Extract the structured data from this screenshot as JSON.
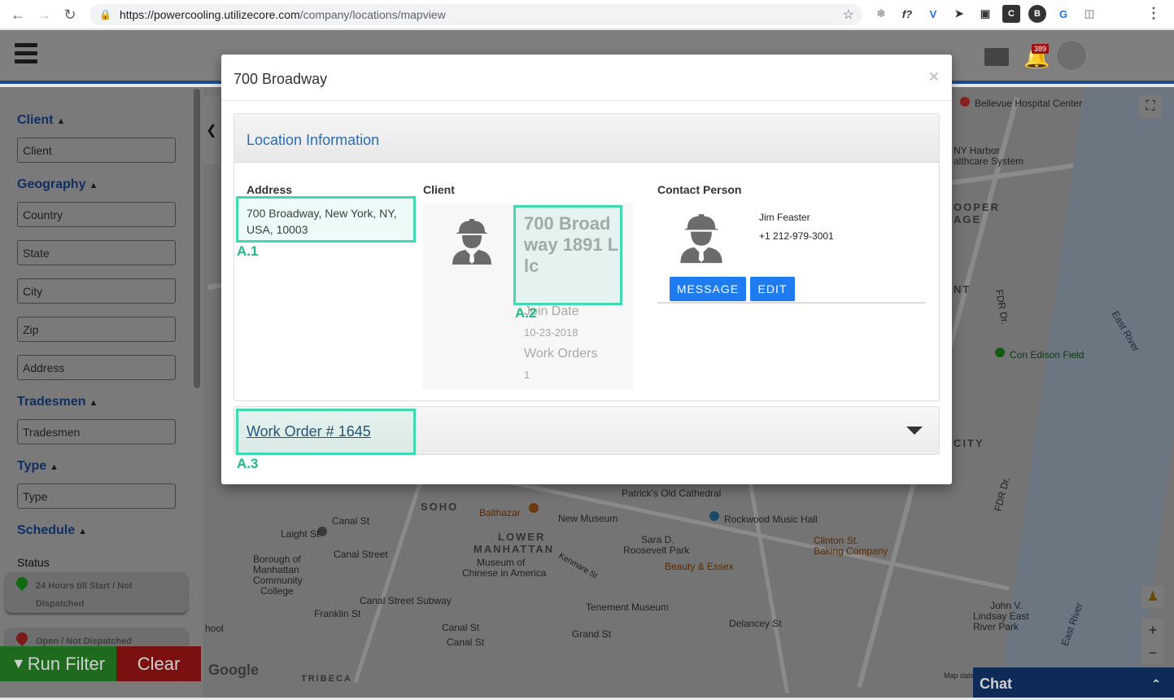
{
  "browser": {
    "url_host": "https://powercooling.utilizecore.com",
    "url_path": "/company/locations/mapview"
  },
  "header": {
    "notification_count": "389"
  },
  "sidebar": {
    "sections": {
      "client": "Client",
      "geography": "Geography",
      "tradesmen": "Tradesmen",
      "type": "Type",
      "schedule": "Schedule"
    },
    "placeholders": {
      "client": "Client",
      "country": "Country",
      "state": "State",
      "city": "City",
      "zip": "Zip",
      "address": "Address",
      "tradesmen": "Tradesmen",
      "type": "Type"
    },
    "status_label": "Status",
    "status_cards": [
      {
        "label": "24 Hours till Start / Not Dispatched",
        "color": "#0f6a0f"
      },
      {
        "label": "Open / Not Dispatched",
        "color": "#7a1a1a"
      }
    ],
    "run_filter_label": "Run Filter",
    "clear_label": "Clear"
  },
  "map": {
    "labels": {
      "bellevue": "Bellevue Hospital Center",
      "ny_harbor": "NY Harbor",
      "healthcare": "althcare System",
      "cooper": "OOPER",
      "age": "AGE",
      "nt": "NT",
      "fdr1": "FDR Dr.",
      "east_river1": "East River",
      "con_edison": "Con Edison Field",
      "city": "CITY",
      "fdr2": "FDR Dr.",
      "soho": "SOHO",
      "balthazar": "Balthazar",
      "new_museum": "New Museum",
      "rockwood": "Rockwood Music Hall",
      "lower": "LOWER",
      "manhattan": "MANHATTAN",
      "museum_chinese_1": "Museum of",
      "museum_chinese_2": "Chinese in America",
      "sara_d": "Sara D.",
      "roosevelt": "Roosevelt Park",
      "clinton_st": "Clinton St.",
      "baking": "Baking Company",
      "beauty": "Beauty & Essex",
      "canal_st_1": "Canal St",
      "canal_street": "Canal Street",
      "canal_street_subway": "Canal Street Subway",
      "canal_st_2": "Canal St",
      "canal_st_3": "Canal St",
      "franklin": "Franklin St",
      "grand_st": "Grand St",
      "tenement": "Tenement Museum",
      "delancey": "Delancey St",
      "john_v_1": "John V.",
      "john_v_2": "Lindsay East",
      "john_v_3": "River Park",
      "east_river2": "East River",
      "borough_1": "Borough of",
      "borough_2": "Manhattan",
      "borough_3": "Community",
      "borough_4": "College",
      "laight": "Laight St",
      "school": "hool",
      "tribeca": "TRIBECA",
      "patricks": "Patrick's Old Cathedral",
      "kenmare": "Kenmare St",
      "map_data": "Map data"
    },
    "google": "Google"
  },
  "chat": {
    "label": "Chat"
  },
  "modal": {
    "title": "700 Broadway",
    "close": "×",
    "panel_title": "Location Information",
    "address_label": "Address",
    "address_value": "700 Broadway, New York, NY, USA, 10003",
    "client_label": "Client",
    "client_name": "700 Broadway 1891 Llc",
    "join_date_label": "Join Date",
    "join_date_value": "10-23-2018",
    "work_orders_label": "Work Orders",
    "work_orders_value": "1",
    "contact_label": "Contact Person",
    "contact_name": "Jim Feaster",
    "contact_phone": "+1 212-979-3001",
    "message_label": "MESSAGE",
    "edit_label": "EDIT",
    "work_order_link": "Work Order # 1645"
  },
  "annotations": {
    "a1": "A.1",
    "a2": "A.2",
    "a3": "A.3",
    "color": "#40d9b0"
  }
}
